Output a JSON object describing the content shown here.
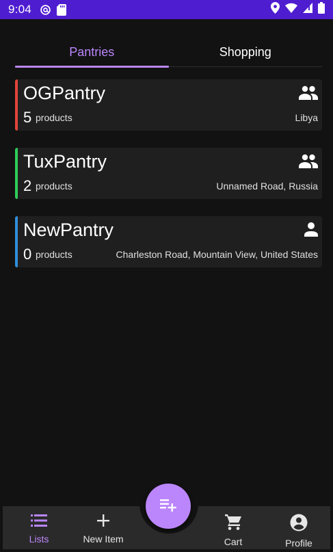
{
  "status_bar": {
    "time": "9:04",
    "icons": [
      "at-sign-icon",
      "sd-card-icon",
      "location-icon",
      "wifi-icon",
      "signal-icon",
      "battery-icon"
    ]
  },
  "tabs": [
    {
      "label": "Pantries",
      "active": true
    },
    {
      "label": "Shopping",
      "active": false
    }
  ],
  "pantries": [
    {
      "title": "OGPantry",
      "count": "5",
      "count_label": "products",
      "location": "Libya",
      "stripe_color": "#e0453a",
      "icon": "group-icon"
    },
    {
      "title": "TuxPantry",
      "count": "2",
      "count_label": "products",
      "location": "Unnamed Road, Russia",
      "stripe_color": "#2ecc5a",
      "icon": "group-icon"
    },
    {
      "title": "NewPantry",
      "count": "0",
      "count_label": "products",
      "location": "Charleston Road, Mountain View, United States",
      "stripe_color": "#2f8fdc",
      "icon": "person-icon"
    }
  ],
  "bottom_nav": {
    "items": [
      {
        "label": "Lists",
        "icon": "list-icon",
        "active": true
      },
      {
        "label": "New Item",
        "icon": "plus-icon",
        "active": false
      },
      {
        "label": "Cart",
        "icon": "cart-icon",
        "active": false
      },
      {
        "label": "Profile",
        "icon": "account-circle-icon",
        "active": false
      }
    ],
    "fab_icon": "playlist-add-icon"
  },
  "colors": {
    "accent": "#bb86fc",
    "status_bar": "#4f1dd0",
    "background": "#121212",
    "card": "#1f1f1f",
    "nav": "#2a2a2a"
  }
}
